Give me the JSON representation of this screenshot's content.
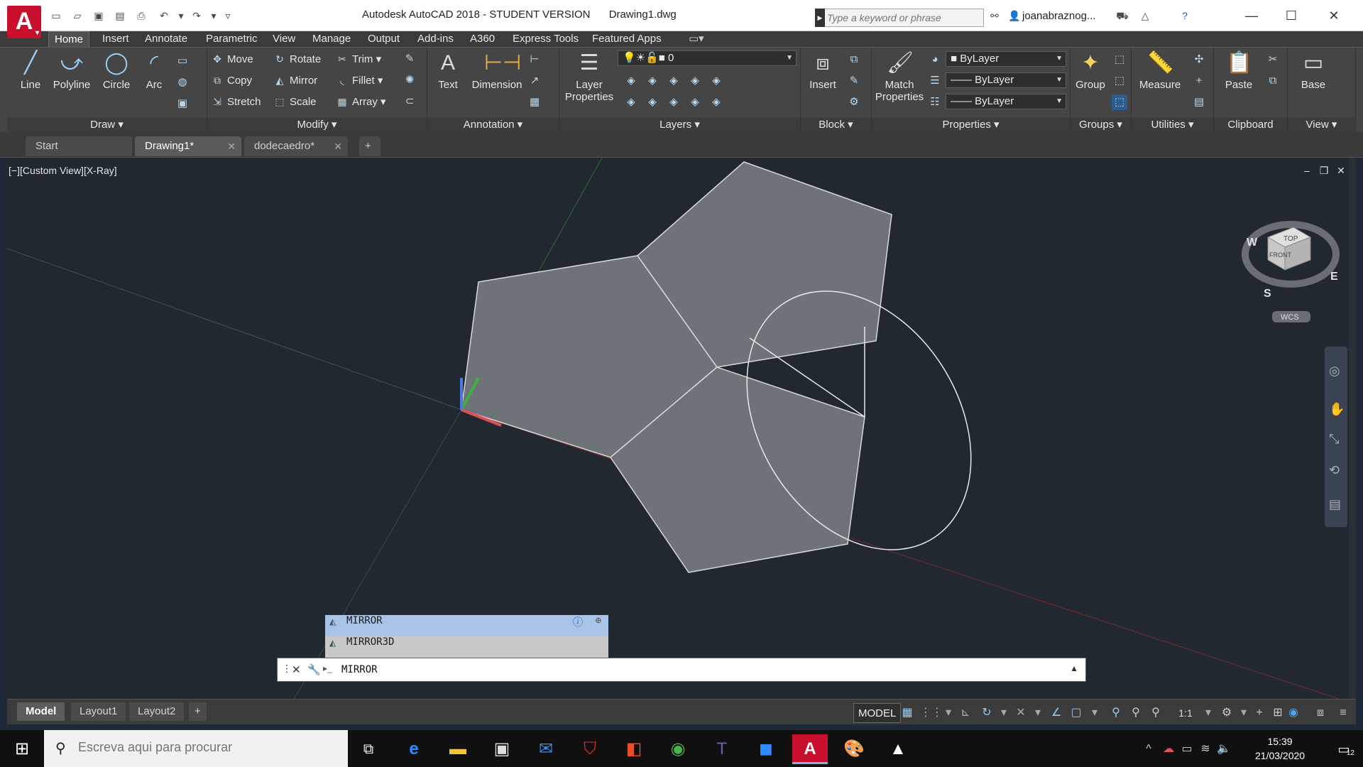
{
  "app": {
    "logo_letter": "A",
    "title": "Autodesk AutoCAD 2018 - STUDENT VERSION",
    "filename": "Drawing1.dwg",
    "search_placeholder": "Type a keyword or phrase",
    "username": "joanabraznog..."
  },
  "ribbon_tabs": [
    "Home",
    "Insert",
    "Annotate",
    "Parametric",
    "View",
    "Manage",
    "Output",
    "Add-ins",
    "A360",
    "Express Tools",
    "Featured Apps"
  ],
  "ribbon": {
    "draw": {
      "title": "Draw",
      "tools": [
        "Line",
        "Polyline",
        "Circle",
        "Arc"
      ]
    },
    "modify": {
      "title": "Modify",
      "tools": [
        "Move",
        "Rotate",
        "Trim",
        "Copy",
        "Mirror",
        "Fillet",
        "Stretch",
        "Scale",
        "Array"
      ]
    },
    "annotation": {
      "title": "Annotation",
      "tools": [
        "Text",
        "Dimension"
      ]
    },
    "layers": {
      "title": "Layers",
      "tool": "Layer Properties",
      "current_layer": "0"
    },
    "block": {
      "title": "Block",
      "tool": "Insert"
    },
    "properties": {
      "title": "Properties",
      "tool": "Match Properties",
      "color": "ByLayer",
      "linetype": "ByLayer",
      "lineweight": "ByLayer"
    },
    "groups": {
      "title": "Groups",
      "tool": "Group"
    },
    "utilities": {
      "title": "Utilities",
      "tool": "Measure"
    },
    "clipboard": {
      "title": "Clipboard",
      "tool": "Paste"
    },
    "view": {
      "title": "View",
      "tool": "Base"
    }
  },
  "doc_tabs": [
    "Start",
    "Drawing1*",
    "dodecaedro*"
  ],
  "viewport": {
    "label": "[−][Custom View][X-Ray]",
    "viewcube": {
      "top": "TOP",
      "front": "FRONT",
      "w": "W",
      "s": "S",
      "e": "E",
      "wcs": "WCS"
    }
  },
  "command": {
    "suggestions": [
      "MIRROR",
      "MIRROR3D"
    ],
    "input": "MIRROR"
  },
  "layouts": [
    "Model",
    "Layout1",
    "Layout2"
  ],
  "status": {
    "model": "MODEL",
    "scale": "1:1"
  },
  "taskbar": {
    "search_placeholder": "Escreva aqui para procurar",
    "time": "15:39",
    "date": "21/03/2020",
    "notifications": "12"
  },
  "colors": {
    "accent": "#c8102e",
    "viewport_bg": "#212830",
    "ribbon_bg": "#454545"
  }
}
